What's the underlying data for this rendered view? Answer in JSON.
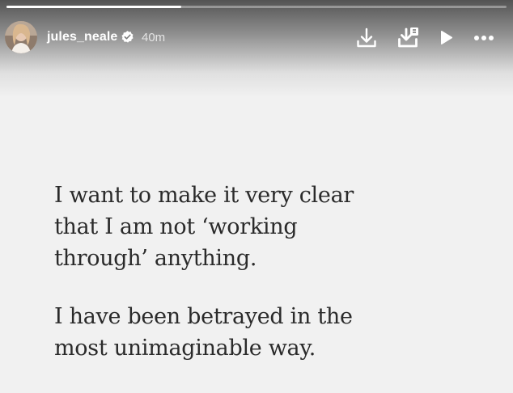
{
  "story": {
    "progress": 0.35,
    "user": {
      "username": "jules_neale",
      "verified": true,
      "posted_ago": "40m"
    },
    "actions": [
      {
        "name": "download",
        "icon": "download-icon"
      },
      {
        "name": "save",
        "icon": "save-to-collection-icon"
      },
      {
        "name": "play",
        "icon": "play-icon"
      },
      {
        "name": "more",
        "icon": "more-options-icon"
      }
    ],
    "text": {
      "paragraph1": [
        "I want to make it very clear",
        "that I am not ‘working",
        "through’ anything."
      ],
      "paragraph2": [
        "I have been betrayed in the",
        "most unimaginable way."
      ]
    }
  },
  "colors": {
    "background": "#f1f1f1",
    "text": "#2a2a2a",
    "header_text": "#ffffff"
  }
}
